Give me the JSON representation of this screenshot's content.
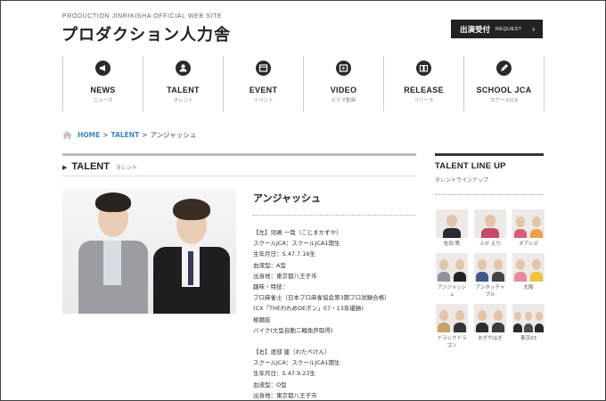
{
  "header": {
    "site_subtitle": "PRODUCTION JINRIKISHA OFFICIAL WEB SITE",
    "logo": "プロダクション人力舎",
    "request_label": "出演受付",
    "request_en": "REQUEST",
    "request_arrow": "›"
  },
  "nav": [
    {
      "label": "NEWS",
      "sub": "ニュース",
      "icon": "megaphone-icon"
    },
    {
      "label": "TALENT",
      "sub": "タレント",
      "icon": "person-icon"
    },
    {
      "label": "EVENT",
      "sub": "イベント",
      "icon": "calendar-icon"
    },
    {
      "label": "VIDEO",
      "sub": "ビデオ動画",
      "icon": "play-icon"
    },
    {
      "label": "RELEASE",
      "sub": "リリース",
      "icon": "book-icon"
    },
    {
      "label": "SCHOOL JCA",
      "sub": "スクールJCA",
      "icon": "pencil-icon"
    }
  ],
  "breadcrumb": {
    "home": "HOME",
    "sep1": ">",
    "talent": "TALENT",
    "sep2": ">",
    "current": "アンジャッシュ"
  },
  "section": {
    "title": "TALENT",
    "subtitle": "タレント"
  },
  "profile": {
    "name": "アンジャッシュ",
    "left": [
      "【左】児嶋 一哉（こじまかずや）",
      "スクールJCA：スクールJCA1期生",
      "生年月日：S.47.7.16生",
      "血液型：A型",
      "出身地：東京都八王子市",
      "趣味・特技：",
      "プロ麻雀士（日本プロ麻雀協会第3期プロ試験合格）",
      "(CX「THEわれめDEポン」07・13年優勝)",
      "極麺抜",
      "バイク(大型自動二輪免許取得)"
    ],
    "right": [
      "【右】渡部 建（わたべけん）",
      "スクールJCA：スクールJCA1期生",
      "生年月日：S.47.9.23生",
      "血液型：O型",
      "出身地：東京都八王子市"
    ]
  },
  "sidebar": {
    "title": "TALENT LINE UP",
    "subtitle": "タレントラインナップ",
    "talents": [
      {
        "name": "佐田 篤"
      },
      {
        "name": "ふせ えり"
      },
      {
        "name": "オアシズ"
      },
      {
        "name": "アンジャッシュ"
      },
      {
        "name": "アンタッチャブル"
      },
      {
        "name": "北陽"
      },
      {
        "name": "ドランクドラゴン"
      },
      {
        "name": "おぎやはぎ"
      },
      {
        "name": "東京03"
      }
    ]
  }
}
